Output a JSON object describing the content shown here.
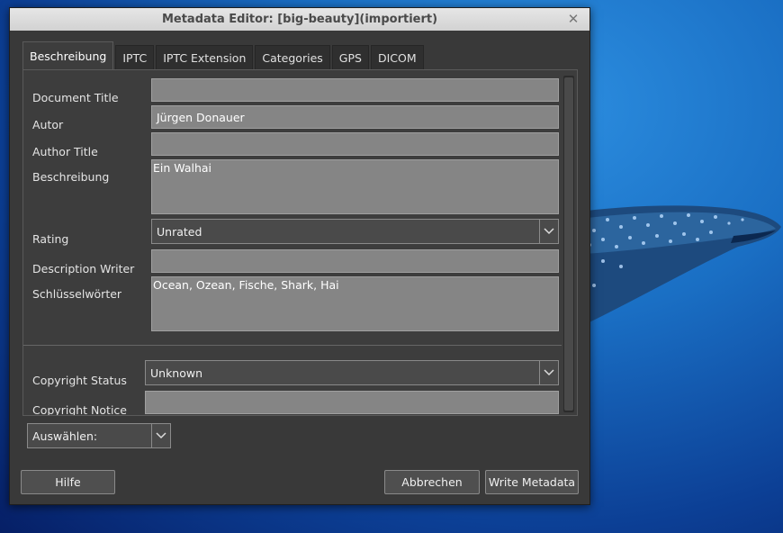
{
  "window": {
    "title": "Metadata Editor: [big-beauty](importiert)"
  },
  "tabs": [
    "Beschreibung",
    "IPTC",
    "IPTC Extension",
    "Categories",
    "GPS",
    "DICOM"
  ],
  "fields": {
    "document_title": {
      "label": "Document Title",
      "value": ""
    },
    "autor": {
      "label": "Autor",
      "value": "Jürgen Donauer"
    },
    "author_title": {
      "label": "Author Title",
      "value": ""
    },
    "beschreibung": {
      "label": "Beschreibung",
      "value": "Ein Walhai"
    },
    "rating": {
      "label": "Rating",
      "value": "Unrated"
    },
    "description_writer": {
      "label": "Description Writer",
      "value": ""
    },
    "schluesselwoerter": {
      "label": "Schlüsselwörter",
      "value": "Ocean, Ozean, Fische, Shark, Hai"
    },
    "copyright_status": {
      "label": "Copyright Status",
      "value": "Unknown"
    },
    "copyright_notice": {
      "label": "Copyright Notice",
      "value": ""
    }
  },
  "select": {
    "value": "Auswählen:"
  },
  "buttons": {
    "help": "Hilfe",
    "cancel": "Abbrechen",
    "write": "Write Metadata"
  }
}
